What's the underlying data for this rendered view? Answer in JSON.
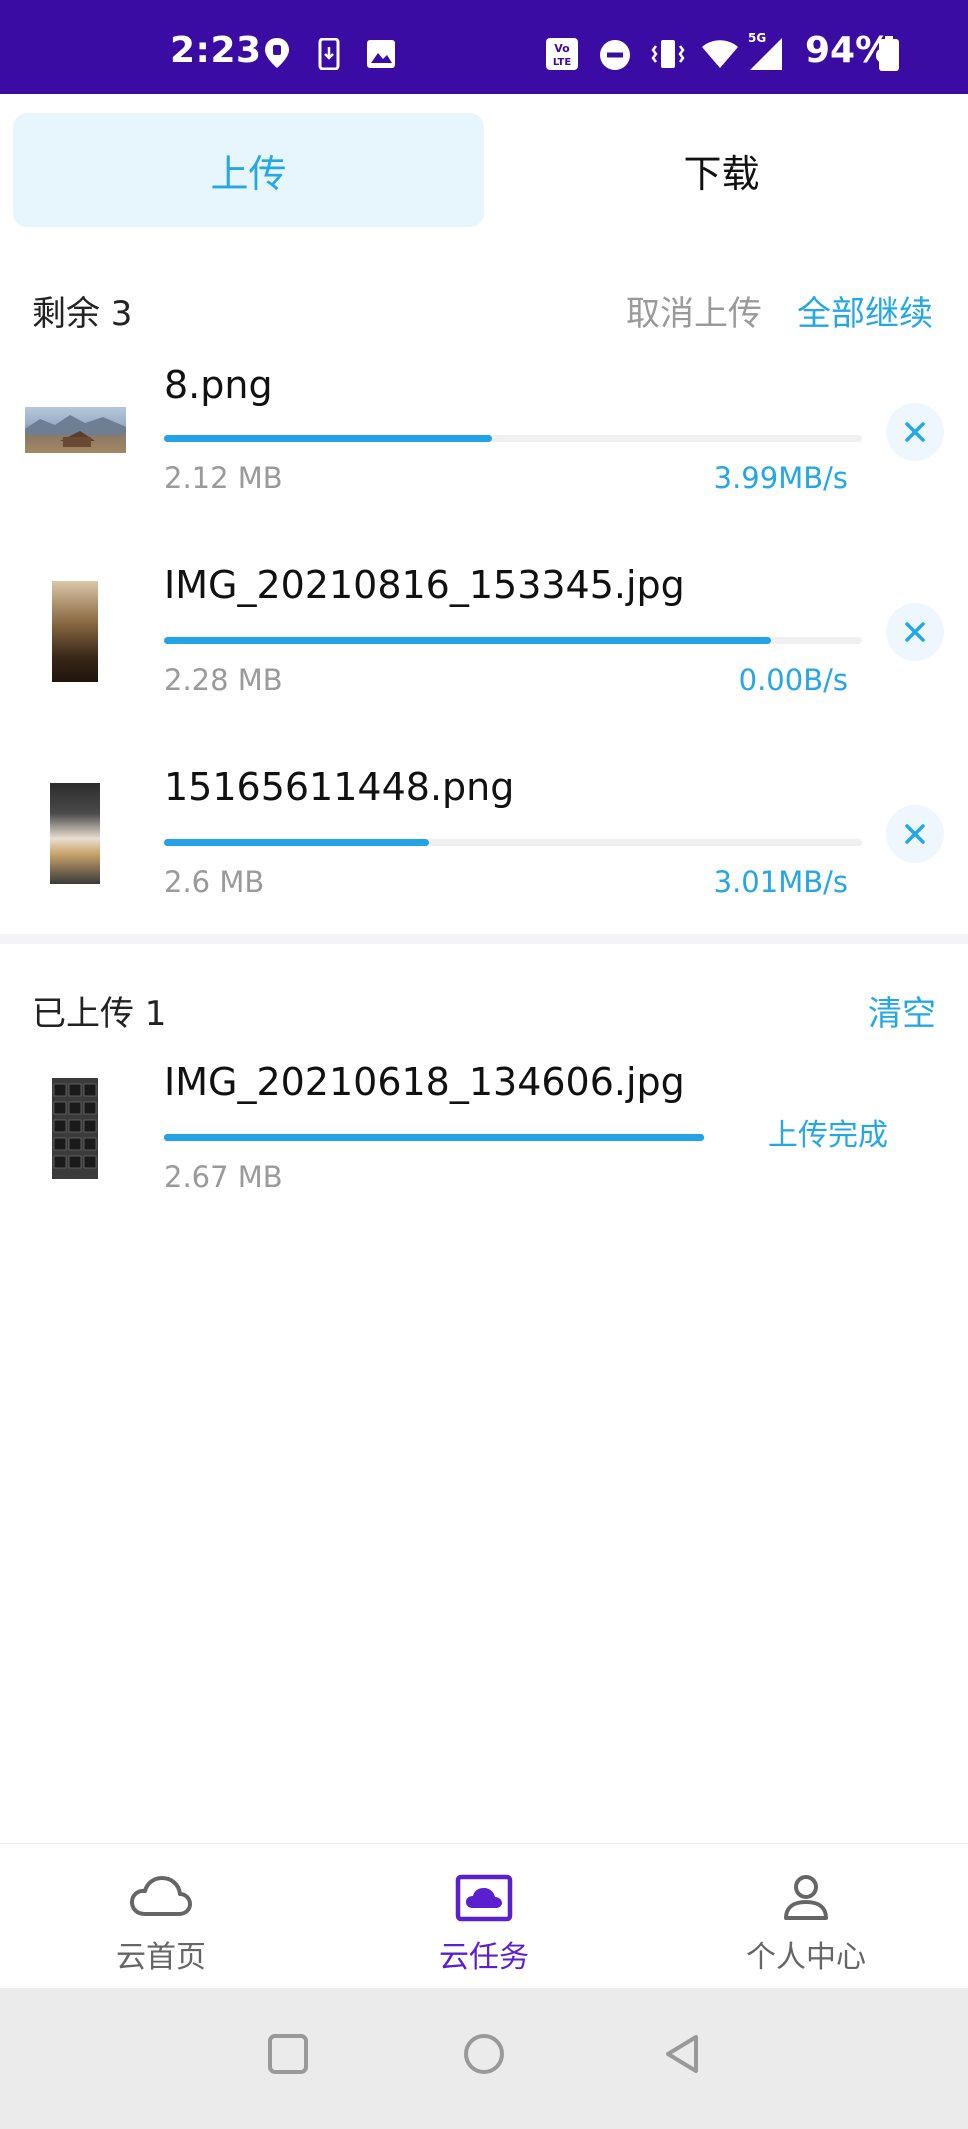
{
  "status_bar": {
    "time": "2:23",
    "battery_percent": "94%",
    "icons": [
      "location-icon",
      "phone-download-icon",
      "image-icon",
      "volte-icon",
      "dnd-icon",
      "vibrate-icon",
      "wifi-icon",
      "5g-signal-icon",
      "battery-icon"
    ],
    "background": "#3a0ca3"
  },
  "tabs": [
    {
      "label": "上传",
      "active": true
    },
    {
      "label": "下载",
      "active": false
    }
  ],
  "remaining_section": {
    "title": "剩余 3",
    "cancel_label": "取消上传",
    "resume_all_label": "全部继续"
  },
  "in_progress": [
    {
      "name": "8.png",
      "size": "2.12 MB",
      "speed": "3.99MB/s",
      "progress": 0.47,
      "thumb": "landscape-photo"
    },
    {
      "name": "IMG_20210816_153345.jpg",
      "size": "2.28 MB",
      "speed": "0.00B/s",
      "progress": 0.87,
      "thumb": "dark-photo"
    },
    {
      "name": "15165611448.png",
      "size": "2.6 MB",
      "speed": "3.01MB/s",
      "progress": 0.38,
      "thumb": "receipt-photo"
    }
  ],
  "uploaded_section": {
    "title": "已上传 1",
    "clear_label": "清空"
  },
  "uploaded": [
    {
      "name": "IMG_20210618_134606.jpg",
      "size": "2.67 MB",
      "status": "上传完成",
      "progress": 1.0,
      "thumb": "keyboard-photo"
    }
  ],
  "bottom_nav": [
    {
      "label": "云首页",
      "icon": "cloud-icon",
      "active": false
    },
    {
      "label": "云任务",
      "icon": "cloud-task-icon",
      "active": true
    },
    {
      "label": "个人中心",
      "icon": "user-icon",
      "active": false
    }
  ],
  "colors": {
    "accent": "#25a7e6",
    "nav_active": "#5b1fd0",
    "nav_inactive": "#666666"
  }
}
